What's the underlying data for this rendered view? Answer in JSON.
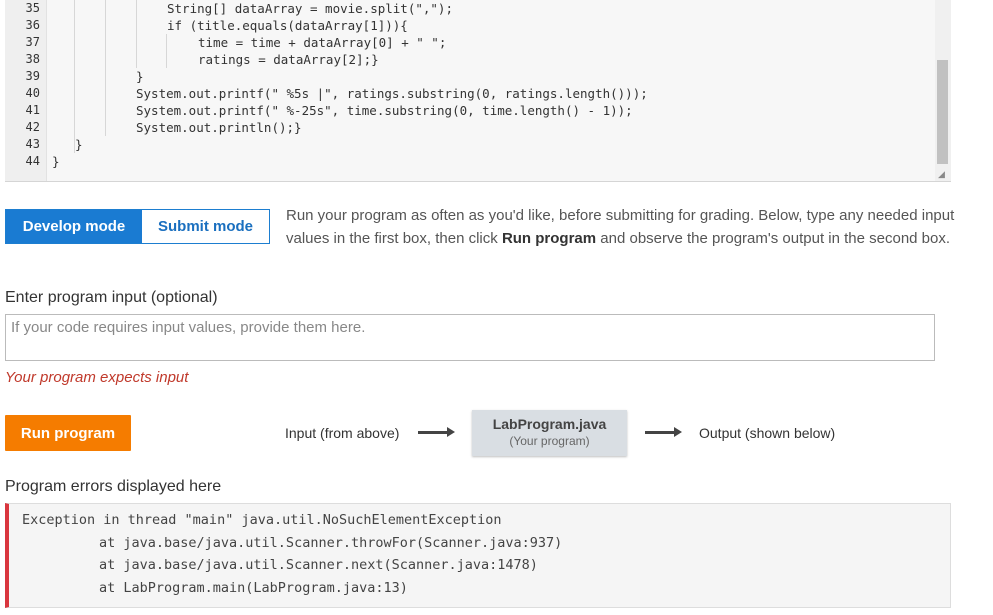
{
  "editor": {
    "line_numbers": [
      "35",
      "36",
      "37",
      "38",
      "39",
      "40",
      "41",
      "42",
      "43",
      "44"
    ],
    "lines": [
      "String[] dataArray = movie.split(\",\");",
      "if (title.equals(dataArray[1])){",
      "time = time + dataArray[0] + \" \";",
      "ratings = dataArray[2];}",
      "}",
      "System.out.printf(\" %5s |\", ratings.substring(0, ratings.length()));",
      "System.out.printf(\" %-25s\", time.substring(0, time.length() - 1));",
      "System.out.println();}",
      "}",
      "}"
    ]
  },
  "mode_toggle": {
    "develop_label": "Develop mode",
    "submit_label": "Submit mode"
  },
  "instructions": {
    "part1": "Run your program as often as you'd like, before submitting for grading. Below, type any needed input values in the first box, then click ",
    "bold": "Run program",
    "part2": " and observe the program's output in the second box."
  },
  "input": {
    "label": "Enter program input (optional)",
    "placeholder": "If your code requires input values, provide them here.",
    "value": "",
    "warning": "Your program expects input"
  },
  "run": {
    "button_label": "Run program",
    "flow_input": "Input (from above)",
    "program_name": "LabProgram.java",
    "program_sub": "(Your program)",
    "flow_output": "Output (shown below)"
  },
  "errors": {
    "label": "Program errors displayed here",
    "lines": [
      "Exception in thread \"main\" java.util.NoSuchElementException",
      "at java.base/java.util.Scanner.throwFor(Scanner.java:937)",
      "at java.base/java.util.Scanner.next(Scanner.java:1478)",
      "at LabProgram.main(LabProgram.java:13)"
    ]
  },
  "colors": {
    "accent_blue": "#1a7bd2",
    "run_orange": "#f57c00",
    "error_red": "#d9363e",
    "warning_red": "#c0392b"
  }
}
